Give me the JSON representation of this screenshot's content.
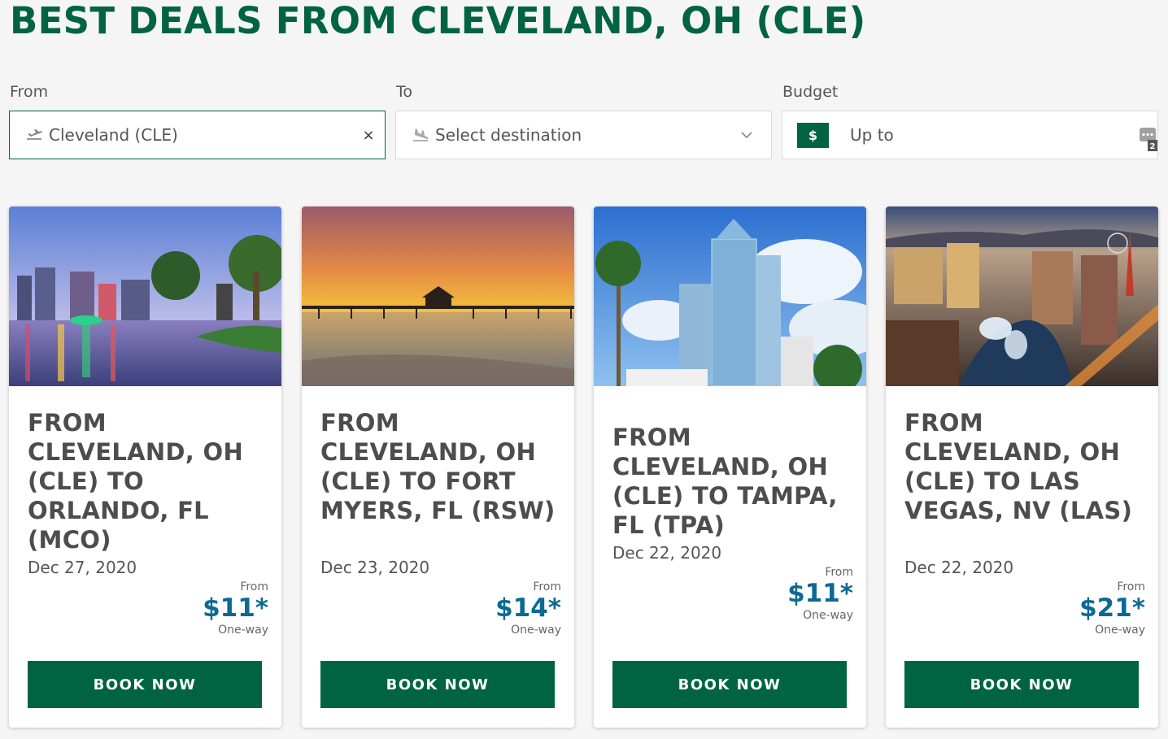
{
  "header": {
    "title": "BEST DEALS FROM CLEVELAND, OH (CLE)"
  },
  "search": {
    "from_label": "From",
    "from_value": "Cleveland (CLE)",
    "to_label": "To",
    "to_placeholder": "Select destination",
    "budget_label": "Budget",
    "budget_currency": "$",
    "budget_placeholder": "Up to"
  },
  "cards": [
    {
      "title": "FROM CLEVELAND, OH (CLE) TO ORLANDO, FL (MCO)",
      "date": "Dec 27, 2020",
      "price_from": "From",
      "price": "$11*",
      "price_note": "One-way",
      "button": "BOOK NOW"
    },
    {
      "title": "FROM CLEVELAND, OH (CLE) TO FORT MYERS, FL (RSW)",
      "date": "Dec 23, 2020",
      "price_from": "From",
      "price": "$14*",
      "price_note": "One-way",
      "button": "BOOK NOW"
    },
    {
      "title": "FROM CLEVELAND, OH (CLE) TO TAMPA, FL (TPA)",
      "date": "Dec 22, 2020",
      "price_from": "From",
      "price": "$11*",
      "price_note": "One-way",
      "button": "BOOK NOW"
    },
    {
      "title": "FROM CLEVELAND, OH (CLE) TO LAS VEGAS, NV (LAS)",
      "date": "Dec 22, 2020",
      "price_from": "From",
      "price": "$21*",
      "price_note": "One-way",
      "button": "BOOK NOW"
    }
  ],
  "colors": {
    "brand_green": "#006341",
    "price_blue": "#0b6993"
  }
}
